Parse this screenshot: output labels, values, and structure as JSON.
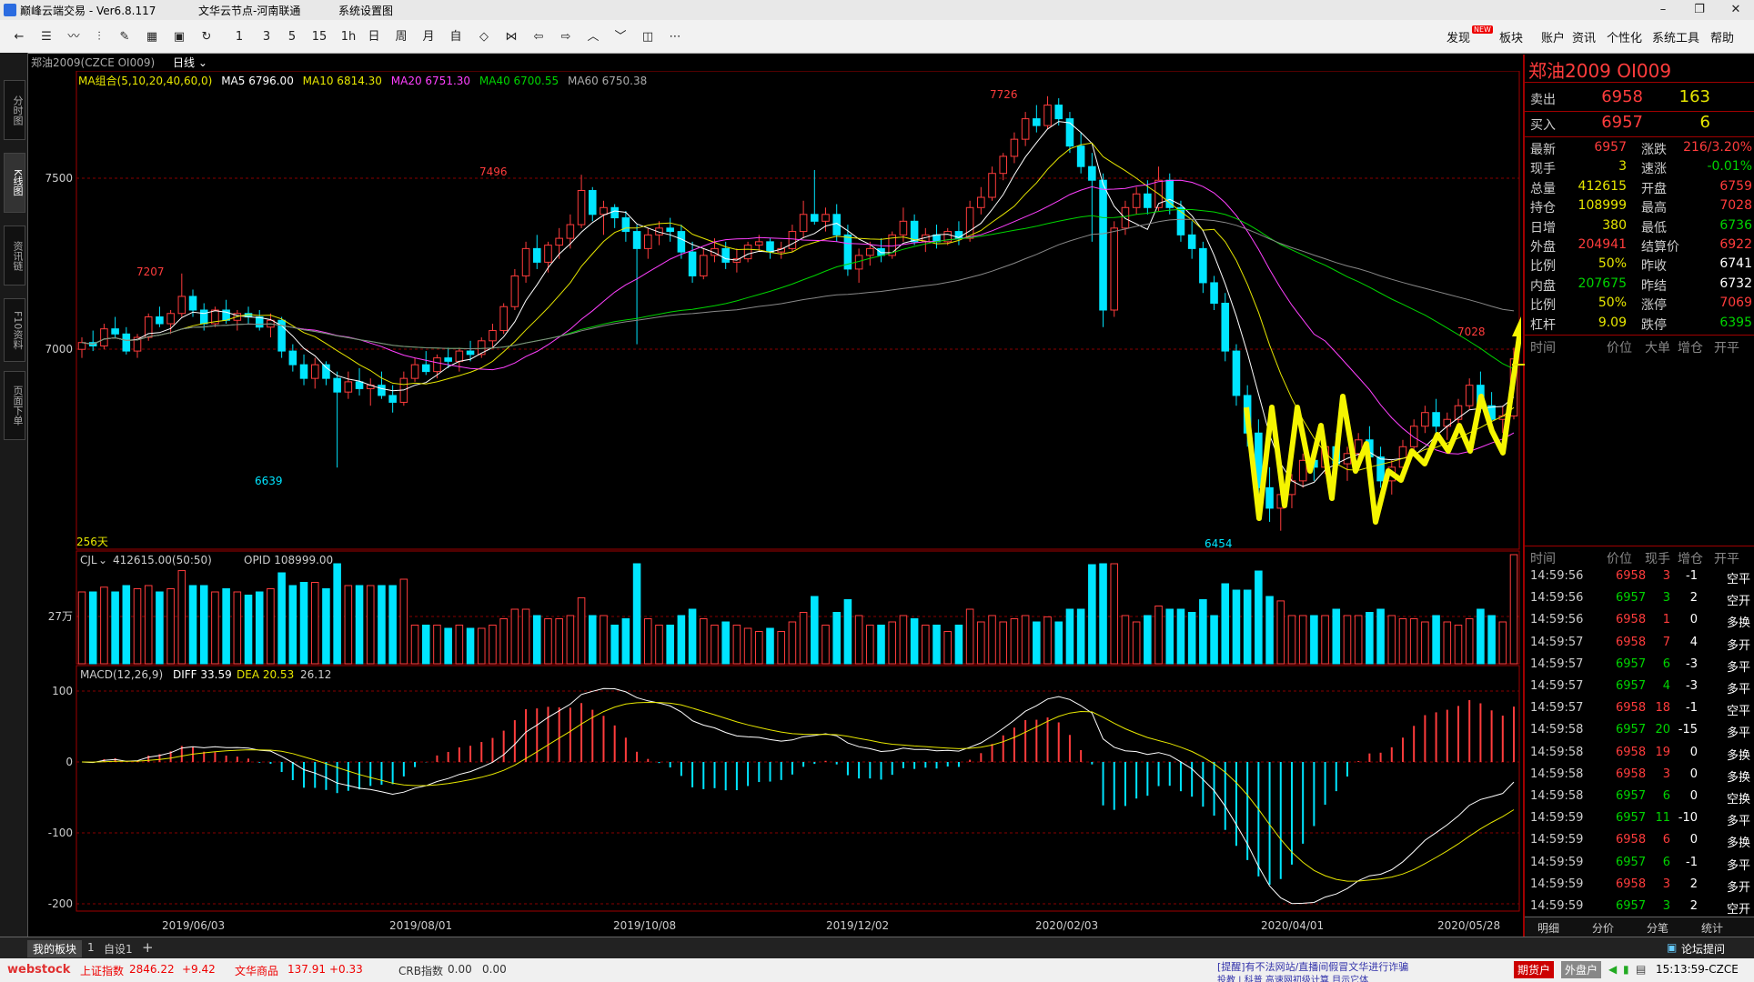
{
  "window": {
    "title": "巅峰云端交易  - Ver6.8.117",
    "menu": [
      "文华云节点-河南联通",
      "系统设置图"
    ]
  },
  "toolbar": {
    "periods": [
      "1",
      "3",
      "5",
      "15",
      "1h",
      "日",
      "周",
      "月",
      "自"
    ],
    "right_menu": [
      "发现",
      "板块",
      "账户",
      "资讯",
      "个性化",
      "系统工具",
      "帮助"
    ],
    "new_badge": "NEW"
  },
  "left_tabs": [
    "分时图",
    "K线图",
    "资讯链",
    "F10资料",
    "页面下单"
  ],
  "chart": {
    "contract": "郑油2009(CZCE OI009)",
    "period": "日线",
    "ma_label": "MA组合(5,10,20,40,60,0)",
    "ma5": "MA5 6796.00",
    "ma10": "MA10 6814.30",
    "ma20": "MA20 6751.30",
    "ma40": "MA40 6700.55",
    "ma60": "MA60 6750.38",
    "y_labels": [
      "7500",
      "7000"
    ],
    "annotations": [
      "7726",
      "7496",
      "7207",
      "6639",
      "6454",
      "7028"
    ],
    "days": "256天",
    "vol_header_name": "CJL",
    "vol_header_value": "412615.00(50:50)",
    "vol_header_opid": "OPID 108999.00",
    "vol_y_label": "27万",
    "macd_header_name": "MACD(12,26,9)",
    "macd_diff": "DIFF 33.59",
    "macd_dea": "DEA 20.53",
    "macd_val": "26.12",
    "macd_y_labels": [
      "100",
      "0",
      "-100",
      "-200"
    ],
    "x_labels": [
      "2019/06/03",
      "2019/08/01",
      "2019/10/08",
      "2019/12/02",
      "2020/02/03",
      "2020/04/01",
      "2020/05/28"
    ]
  },
  "chart_data": {
    "type": "candlestick",
    "candles": [
      [
        6985,
        7020,
        6960,
        7005
      ],
      [
        7005,
        7040,
        6980,
        6995
      ],
      [
        6995,
        7060,
        6985,
        7045
      ],
      [
        7045,
        7080,
        7020,
        7030
      ],
      [
        7030,
        7050,
        6970,
        6980
      ],
      [
        6980,
        7030,
        6960,
        7020
      ],
      [
        7020,
        7090,
        7010,
        7080
      ],
      [
        7080,
        7110,
        7050,
        7060
      ],
      [
        7060,
        7100,
        7030,
        7090
      ],
      [
        7090,
        7207,
        7080,
        7140
      ],
      [
        7140,
        7160,
        7080,
        7100
      ],
      [
        7100,
        7120,
        7040,
        7060
      ],
      [
        7060,
        7110,
        7050,
        7100
      ],
      [
        7100,
        7130,
        7060,
        7070
      ],
      [
        7070,
        7100,
        7040,
        7090
      ],
      [
        7090,
        7110,
        7060,
        7080
      ],
      [
        7080,
        7100,
        7040,
        7050
      ],
      [
        7050,
        7090,
        7020,
        7070
      ],
      [
        7070,
        7080,
        6960,
        6980
      ],
      [
        6980,
        7000,
        6920,
        6940
      ],
      [
        6940,
        6970,
        6880,
        6900
      ],
      [
        6900,
        6960,
        6870,
        6940
      ],
      [
        6940,
        6950,
        6880,
        6900
      ],
      [
        6900,
        6920,
        6639,
        6860
      ],
      [
        6860,
        6920,
        6840,
        6890
      ],
      [
        6890,
        6930,
        6850,
        6870
      ],
      [
        6870,
        6900,
        6820,
        6880
      ],
      [
        6880,
        6920,
        6840,
        6850
      ],
      [
        6850,
        6880,
        6800,
        6830
      ],
      [
        6830,
        6920,
        6820,
        6900
      ],
      [
        6900,
        6960,
        6890,
        6940
      ],
      [
        6940,
        6980,
        6910,
        6920
      ],
      [
        6920,
        6970,
        6900,
        6960
      ],
      [
        6960,
        6990,
        6930,
        6950
      ],
      [
        6950,
        6990,
        6920,
        6980
      ],
      [
        6980,
        7010,
        6950,
        6970
      ],
      [
        6970,
        7020,
        6960,
        7010
      ],
      [
        7010,
        7060,
        6990,
        7040
      ],
      [
        7040,
        7120,
        7030,
        7110
      ],
      [
        7110,
        7220,
        7100,
        7200
      ],
      [
        7200,
        7300,
        7180,
        7280
      ],
      [
        7280,
        7320,
        7220,
        7240
      ],
      [
        7240,
        7300,
        7210,
        7290
      ],
      [
        7290,
        7340,
        7250,
        7310
      ],
      [
        7310,
        7380,
        7280,
        7350
      ],
      [
        7350,
        7496,
        7340,
        7450
      ],
      [
        7450,
        7460,
        7360,
        7380
      ],
      [
        7380,
        7420,
        7320,
        7400
      ],
      [
        7400,
        7410,
        7340,
        7370
      ],
      [
        7370,
        7390,
        7300,
        7330
      ],
      [
        7330,
        7350,
        7000,
        7280
      ],
      [
        7280,
        7340,
        7250,
        7320
      ],
      [
        7320,
        7360,
        7290,
        7340
      ],
      [
        7340,
        7370,
        7300,
        7330
      ],
      [
        7330,
        7350,
        7250,
        7270
      ],
      [
        7270,
        7300,
        7180,
        7200
      ],
      [
        7200,
        7280,
        7190,
        7260
      ],
      [
        7260,
        7310,
        7240,
        7280
      ],
      [
        7280,
        7300,
        7220,
        7240
      ],
      [
        7240,
        7280,
        7210,
        7250
      ],
      [
        7250,
        7300,
        7240,
        7290
      ],
      [
        7290,
        7320,
        7270,
        7300
      ],
      [
        7300,
        7310,
        7250,
        7270
      ],
      [
        7270,
        7300,
        7250,
        7280
      ],
      [
        7280,
        7350,
        7270,
        7330
      ],
      [
        7330,
        7420,
        7310,
        7380
      ],
      [
        7380,
        7510,
        7350,
        7360
      ],
      [
        7360,
        7400,
        7330,
        7380
      ],
      [
        7380,
        7410,
        7300,
        7320
      ],
      [
        7320,
        7350,
        7200,
        7220
      ],
      [
        7220,
        7280,
        7180,
        7260
      ],
      [
        7260,
        7300,
        7230,
        7280
      ],
      [
        7280,
        7310,
        7240,
        7260
      ],
      [
        7260,
        7330,
        7250,
        7320
      ],
      [
        7320,
        7400,
        7300,
        7360
      ],
      [
        7360,
        7380,
        7290,
        7300
      ],
      [
        7300,
        7340,
        7270,
        7320
      ],
      [
        7320,
        7350,
        7280,
        7300
      ],
      [
        7300,
        7340,
        7290,
        7330
      ],
      [
        7330,
        7360,
        7290,
        7310
      ],
      [
        7310,
        7420,
        7300,
        7400
      ],
      [
        7400,
        7460,
        7380,
        7430
      ],
      [
        7430,
        7520,
        7420,
        7500
      ],
      [
        7500,
        7560,
        7480,
        7550
      ],
      [
        7550,
        7620,
        7530,
        7600
      ],
      [
        7600,
        7680,
        7580,
        7660
      ],
      [
        7660,
        7700,
        7620,
        7640
      ],
      [
        7640,
        7726,
        7630,
        7700
      ],
      [
        7700,
        7720,
        7640,
        7660
      ],
      [
        7660,
        7680,
        7560,
        7580
      ],
      [
        7580,
        7620,
        7500,
        7520
      ],
      [
        7520,
        7560,
        7300,
        7480
      ],
      [
        7480,
        7500,
        7050,
        7100
      ],
      [
        7100,
        7360,
        7080,
        7340
      ],
      [
        7340,
        7420,
        7320,
        7400
      ],
      [
        7400,
        7460,
        7380,
        7440
      ],
      [
        7440,
        7480,
        7380,
        7400
      ],
      [
        7400,
        7520,
        7390,
        7480
      ],
      [
        7480,
        7500,
        7380,
        7400
      ],
      [
        7400,
        7420,
        7300,
        7320
      ],
      [
        7320,
        7360,
        7250,
        7280
      ],
      [
        7280,
        7300,
        7150,
        7180
      ],
      [
        7180,
        7200,
        7100,
        7120
      ],
      [
        7120,
        7150,
        6950,
        6980
      ],
      [
        6980,
        7000,
        6820,
        6850
      ],
      [
        6850,
        6880,
        6700,
        6740
      ],
      [
        6740,
        6780,
        6540,
        6580
      ],
      [
        6580,
        6640,
        6480,
        6520
      ],
      [
        6520,
        6600,
        6454,
        6560
      ],
      [
        6560,
        6620,
        6520,
        6600
      ],
      [
        6600,
        6680,
        6580,
        6660
      ],
      [
        6660,
        6700,
        6600,
        6640
      ],
      [
        6640,
        6720,
        6620,
        6700
      ],
      [
        6700,
        6740,
        6620,
        6650
      ],
      [
        6650,
        6700,
        6600,
        6680
      ],
      [
        6680,
        6740,
        6640,
        6720
      ],
      [
        6720,
        6760,
        6650,
        6670
      ],
      [
        6670,
        6700,
        6580,
        6600
      ],
      [
        6600,
        6660,
        6560,
        6640
      ],
      [
        6640,
        6720,
        6630,
        6700
      ],
      [
        6700,
        6780,
        6690,
        6760
      ],
      [
        6760,
        6820,
        6740,
        6800
      ],
      [
        6800,
        6840,
        6740,
        6760
      ],
      [
        6760,
        6800,
        6720,
        6780
      ],
      [
        6780,
        6840,
        6770,
        6820
      ],
      [
        6820,
        6900,
        6810,
        6880
      ],
      [
        6880,
        6920,
        6800,
        6820
      ],
      [
        6820,
        6860,
        6760,
        6780
      ],
      [
        6780,
        6820,
        6740,
        6790
      ],
      [
        6790,
        6990,
        6780,
        6957
      ]
    ],
    "volume_ma_note": "",
    "price_range": [
      6400,
      7800
    ],
    "macd_range": [
      -220,
      130
    ]
  },
  "quote_panel": {
    "name": "郑油2009  OI009",
    "ask_label": "卖出",
    "ask_price": "6958",
    "ask_vol": "163",
    "bid_label": "买入",
    "bid_price": "6957",
    "bid_vol": "6",
    "rows": [
      {
        "k1": "最新",
        "v1": "6957",
        "c1": "red",
        "k2": "涨跌",
        "v2": "216/3.20%",
        "c2": "red"
      },
      {
        "k1": "现手",
        "v1": "3",
        "c1": "yel",
        "k2": "速涨",
        "v2": "-0.01%",
        "c2": "grn"
      },
      {
        "k1": "总量",
        "v1": "412615",
        "c1": "yel",
        "k2": "开盘",
        "v2": "6759",
        "c2": "red"
      },
      {
        "k1": "持仓",
        "v1": "108999",
        "c1": "yel",
        "k2": "最高",
        "v2": "7028",
        "c2": "red"
      },
      {
        "k1": "日增",
        "v1": "380",
        "c1": "yel",
        "k2": "最低",
        "v2": "6736",
        "c2": "grn"
      },
      {
        "k1": "外盘",
        "v1": "204941",
        "c1": "red",
        "k2": "结算价",
        "v2": "6922",
        "c2": "red"
      },
      {
        "k1": "比例",
        "v1": "50%",
        "c1": "yel",
        "k2": "昨收",
        "v2": "6741",
        "c2": "wht"
      },
      {
        "k1": "内盘",
        "v1": "207675",
        "c1": "grn",
        "k2": "昨结",
        "v2": "6732",
        "c2": "wht"
      },
      {
        "k1": "比例",
        "v1": "50%",
        "c1": "yel",
        "k2": "涨停",
        "v2": "7069",
        "c2": "red"
      },
      {
        "k1": "杠杆",
        "v1": "9.09",
        "c1": "yel",
        "k2": "跌停",
        "v2": "6395",
        "c2": "grn"
      }
    ],
    "bigorder_headers": [
      "时间",
      "价位",
      "大单",
      "增仓",
      "开平"
    ],
    "tick_headers": [
      "时间",
      "价位",
      "现手",
      "增仓",
      "开平"
    ],
    "ticks": [
      [
        "14:59:56",
        "6958",
        "3",
        "-1",
        "空平"
      ],
      [
        "14:59:56",
        "6957",
        "3",
        "2",
        "空开"
      ],
      [
        "14:59:56",
        "6958",
        "1",
        "0",
        "多换"
      ],
      [
        "14:59:57",
        "6958",
        "7",
        "4",
        "多开"
      ],
      [
        "14:59:57",
        "6957",
        "6",
        "-3",
        "多平"
      ],
      [
        "14:59:57",
        "6957",
        "4",
        "-3",
        "多平"
      ],
      [
        "14:59:57",
        "6958",
        "18",
        "-1",
        "空平"
      ],
      [
        "14:59:58",
        "6957",
        "20",
        "-15",
        "多平"
      ],
      [
        "14:59:58",
        "6958",
        "19",
        "0",
        "多换"
      ],
      [
        "14:59:58",
        "6958",
        "3",
        "0",
        "多换"
      ],
      [
        "14:59:58",
        "6957",
        "6",
        "0",
        "空换"
      ],
      [
        "14:59:59",
        "6957",
        "11",
        "-10",
        "多平"
      ],
      [
        "14:59:59",
        "6958",
        "6",
        "0",
        "多换"
      ],
      [
        "14:59:59",
        "6957",
        "6",
        "-1",
        "多平"
      ],
      [
        "14:59:59",
        "6958",
        "3",
        "2",
        "多开"
      ],
      [
        "14:59:59",
        "6957",
        "3",
        "2",
        "空开"
      ]
    ],
    "bottom_tabs": [
      "明细",
      "分价",
      "分笔",
      "统计"
    ]
  },
  "bottom_tabs": {
    "my_board": "我的板块",
    "num1": "1",
    "custom": "自设1",
    "add": "+",
    "forum": "论坛提问"
  },
  "statusbar": {
    "logo": "webstock",
    "idx1_name": "上证指数",
    "idx1_val": "2846.22",
    "idx1_chg": "+9.42",
    "idx2_name": "文华商品",
    "idx2_val": "137.91",
    "idx2_chg": "+0.33",
    "idx3_name": "CRB指数",
    "idx3_val": "0.00",
    "idx3_chg": "0.00",
    "news_line1": "[提醒]有不法网站/直播间假冒文华进行诈骗",
    "news_line2": "投教 | 科普   高速网初级计算 目示它体",
    "btn_futures": "期货户",
    "btn_outer": "外盘户",
    "clock": "15:13:59-CZCE"
  }
}
